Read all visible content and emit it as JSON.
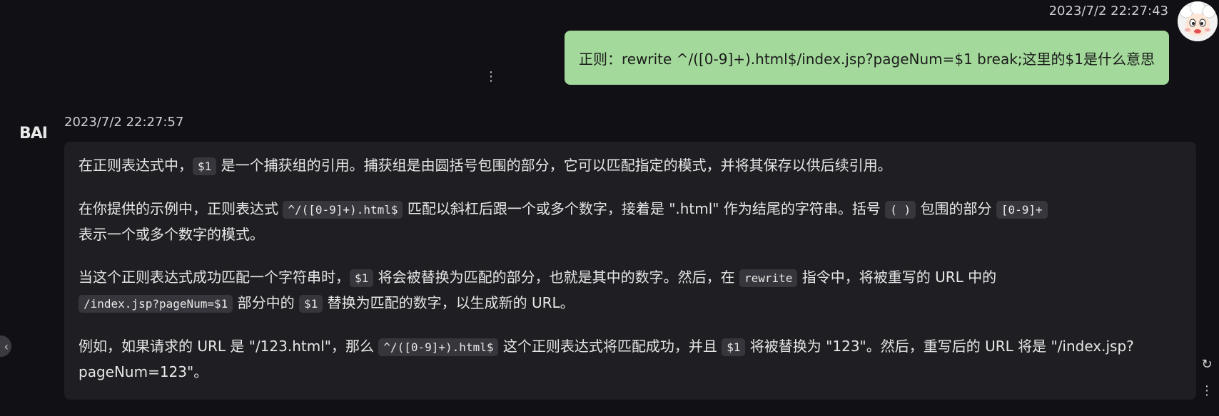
{
  "user_message": {
    "timestamp": "2023/7/2 22:27:43",
    "text": "正则：rewrite ^/([0-9]+).html$/index.jsp?pageNum=$1 break;这里的$1是什么意思",
    "menu_icon": "⋮",
    "bubble_color": "#a3d99a"
  },
  "bot_message": {
    "logo": "BAI",
    "timestamp": "2023/7/2 22:27:57",
    "paragraphs": {
      "p1": {
        "t1": "在正则表达式中，",
        "c1": "$1",
        "t2": " 是一个捕获组的引用。捕获组是由圆括号包围的部分，它可以匹配指定的模式，并将其保存以供后续引用。"
      },
      "p2": {
        "t1": "在你提供的示例中，正则表达式 ",
        "c1": "^/([0-9]+).html$",
        "t2": " 匹配以斜杠后跟一个或多个数字，接着是 \".html\" 作为结尾的字符串。括号 ",
        "c2": "( )",
        "t3": " 包围的部分 ",
        "c3": "[0-9]+",
        "t4": " 表示一个或多个数字的模式。"
      },
      "p3": {
        "t1": "当这个正则表达式成功匹配一个字符串时，",
        "c1": "$1",
        "t2": " 将会被替换为匹配的部分，也就是其中的数字。然后，在 ",
        "c2": "rewrite",
        "t3": " 指令中，将被重写的 URL 中的 ",
        "c3": "/index.jsp?pageNum=$1",
        "t4": " 部分中的 ",
        "c4": "$1",
        "t5": " 替换为匹配的数字，以生成新的 URL。"
      },
      "p4": {
        "t1": "例如，如果请求的 URL 是 \"/123.html\"，那么 ",
        "c1": "^/([0-9]+).html$",
        "t2": " 这个正则表达式将匹配成功，并且 ",
        "c2": "$1",
        "t3": " 将被替换为 \"123\"。然后，重写后的 URL 将是 \"/index.jsp?pageNum=123\"。"
      }
    }
  },
  "controls": {
    "collapse_icon": "‹",
    "refresh_icon": "↻",
    "more_icon": "⋮"
  }
}
